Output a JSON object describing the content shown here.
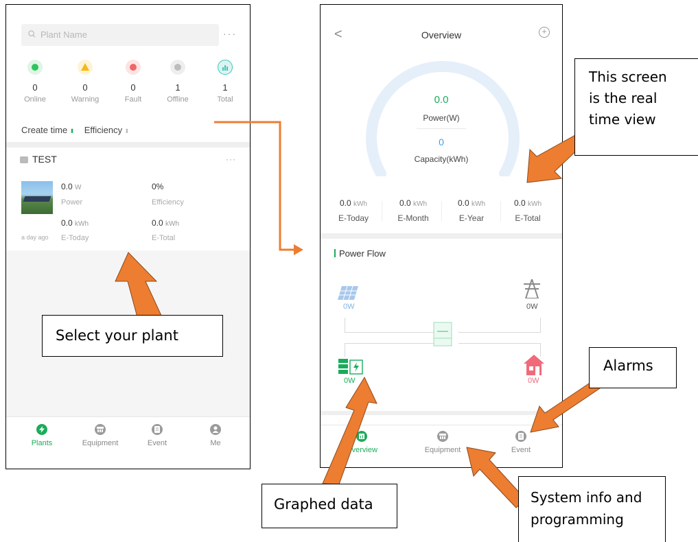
{
  "plants_screen": {
    "search_placeholder": "Plant Name",
    "more": "···",
    "stats": [
      {
        "value": "0",
        "label": "Online",
        "color": "#2fc55d",
        "bg": "#dff5e6"
      },
      {
        "value": "0",
        "label": "Warning",
        "color": "#f5b816",
        "bg": "#fdf3d6"
      },
      {
        "value": "0",
        "label": "Fault",
        "color": "#f06666",
        "bg": "#fde3e3"
      },
      {
        "value": "1",
        "label": "Offline",
        "color": "#9a9a9a",
        "bg": "#eeeeee"
      },
      {
        "value": "1",
        "label": "Total",
        "color": "#3cc7b8",
        "bg": "#dcf4f1"
      }
    ],
    "sort": {
      "create_time": "Create time",
      "efficiency": "Efficiency",
      "arrow": "⬍"
    },
    "plant": {
      "name": "TEST",
      "more": "···",
      "power_value": "0.0",
      "power_unit": "W",
      "power_label": "Power",
      "efficiency_value": "0%",
      "efficiency_label": "Efficiency",
      "etoday_value": "0.0",
      "etoday_unit": "kWh",
      "etoday_label": "E-Today",
      "etotal_value": "0.0",
      "etotal_unit": "kWh",
      "etotal_label": "E-Total",
      "updated": "a day ago"
    },
    "tabs": [
      {
        "label": "Plants",
        "icon": "bolt-icon"
      },
      {
        "label": "Equipment",
        "icon": "inverter-icon"
      },
      {
        "label": "Event",
        "icon": "document-icon"
      },
      {
        "label": "Me",
        "icon": "user-icon"
      }
    ]
  },
  "overview_screen": {
    "back": "<",
    "title": "Overview",
    "add": "+",
    "power_value": "0.0",
    "power_label": "Power(W)",
    "capacity_value": "0",
    "capacity_label": "Capacity(kWh)",
    "energy": [
      {
        "value": "0.0",
        "unit": "kWh",
        "label": "E-Today"
      },
      {
        "value": "0.0",
        "unit": "kWh",
        "label": "E-Month"
      },
      {
        "value": "0.0",
        "unit": "kWh",
        "label": "E-Year"
      },
      {
        "value": "0.0",
        "unit": "kWh",
        "label": "E-Total"
      }
    ],
    "power_flow_title": "Power Flow",
    "pv_value": "0W",
    "grid_value": "0W",
    "battery_value": "0W",
    "load_value": "0W",
    "tabs": [
      {
        "label": "Overview",
        "icon": "overview-icon"
      },
      {
        "label": "Equipment",
        "icon": "inverter-icon"
      },
      {
        "label": "Event",
        "icon": "document-icon"
      }
    ]
  },
  "annotations": {
    "select_plant": "Select your plant",
    "realtime_line1": "This screen",
    "realtime_line2": "is the real",
    "realtime_line3": "time view",
    "alarms": "Alarms",
    "graphed": "Graphed data",
    "sysinfo_line1": "System info and",
    "sysinfo_line2": "programming"
  },
  "colors": {
    "accent": "#1aac5a",
    "arrow": "#ed7d31",
    "gauge": "#e5effa",
    "value_blue": "#3aa0e8"
  }
}
